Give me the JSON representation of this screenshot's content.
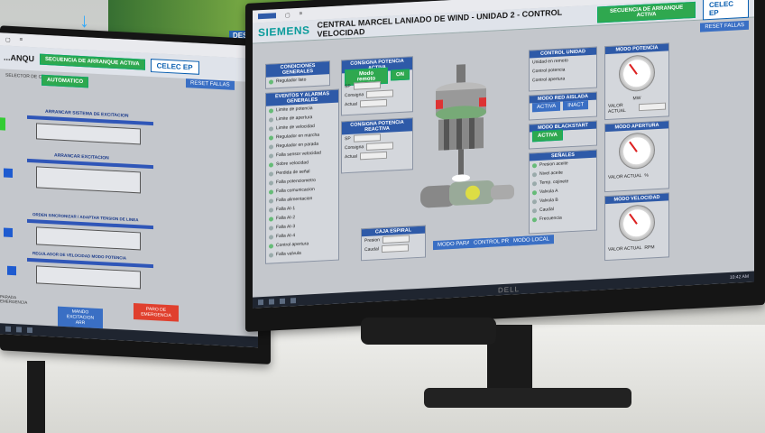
{
  "background": {
    "banner_label": "DESCARGA RIO",
    "arrow_icon": "down-arrow-icon"
  },
  "right_app": {
    "brand": "SIEMENS",
    "title": "CENTRAL MARCEL LANIADO DE WIND - UNIDAD 2 - CONTROL VELOCIDAD",
    "sequence_button": "SECUENCIA DE ARRANQUE ACTIVA",
    "logo": "CELEC EP",
    "reset_button": "RESET FALLAS",
    "panels": {
      "condiciones": {
        "header": "CONDICIONES GENERALES",
        "rows": [
          "Regulador listo"
        ]
      },
      "eventos": {
        "header": "EVENTOS Y ALARMAS GENERALES",
        "rows": [
          "Limite de potencia",
          "Limite de apertura",
          "Limite de velocidad",
          "Regulador en marcha",
          "Regulador en parada",
          "Falla sensor velocidad",
          "Sobre velocidad",
          "Perdida de señal",
          "Falla potenciometro",
          "Falla comunicacion",
          "Falla alimentacion",
          "Falla AI-1",
          "Falla AI-2",
          "Falla AI-3",
          "Falla AI-4",
          "Control apertura",
          "Falla valvula"
        ]
      },
      "consigna_activa": {
        "header": "CONSIGNA POTENCIA ACTIVA",
        "rows": [
          "SP",
          "Consigna",
          "Actual"
        ],
        "btn_a": "Modo remoto",
        "btn_b": "ON"
      },
      "consigna_reactiva": {
        "header": "CONSIGNA POTENCIA REACTIVA",
        "rows": [
          "SP",
          "Consigna",
          "Actual"
        ]
      },
      "control_unidad": {
        "header": "CONTROL UNIDAD",
        "rows": [
          "Unidad en remoto",
          "Control potencia",
          "Control apertura"
        ]
      },
      "modo_red": {
        "header": "MODO RED AISLADA",
        "btn_a": "ACTIVA",
        "btn_b": "INACT"
      },
      "modo_blackstart": {
        "header": "MODO BLACKSTART",
        "btn_a": "ACTIVA"
      },
      "senales": {
        "header": "SEÑALES",
        "rows": [
          "Presion aceite",
          "Nivel aceite",
          "Temp. cojinete",
          "Valvula A",
          "Valvula B",
          "Caudal",
          "Frecuencia"
        ]
      },
      "gauge_potencia": {
        "header": "MODO POTENCIA",
        "unit": "MW",
        "label": "VALOR ACTUAL"
      },
      "gauge_apertura": {
        "header": "MODO APERTURA",
        "unit": "%",
        "label": "VALOR ACTUAL"
      },
      "gauge_velocidad": {
        "header": "MODO VELOCIDAD",
        "unit": "RPM",
        "label": "VALOR ACTUAL"
      },
      "caja_espiral": {
        "header": "CAJA ESPIRAL",
        "rows": [
          "Presion",
          "Caudal"
        ]
      },
      "bottom_buttons": [
        "MODO PARALELO",
        "CONTROL PRESION",
        "MODO LOCAL"
      ]
    },
    "taskbar_clock": "10:42 AM"
  },
  "left_app": {
    "title": "...ANQU",
    "sequence_button": "SECUENCIA DE ARRANQUE ACTIVA",
    "logo": "CELEC EP",
    "selector": "SELECTOR DE CONTROL",
    "selector_value": "AUTOMATICO",
    "reset_button": "RESET FALLAS",
    "steps": [
      "ARRANCAR SISTEMA DE EXCITACION",
      "ARRANCAR EXCITACION",
      "ORDEN SINCRONIZAR / ADAPTAR TENSION DE LINEA",
      "REGULADOR DE VELOCIDAD MODO POTENCIA"
    ],
    "footer_btn_a": "MANDO EXCITACION ARR",
    "footer_btn_b": "PARO DE EMERGENCIA",
    "side_label": "PARADA EMERGENCIA"
  },
  "monitor": {
    "brand": "DELL"
  },
  "colors": {
    "accent_blue": "#2e5aa8",
    "green": "#2fa84f",
    "red": "#e0402e",
    "brand_teal": "#0a9b9b"
  }
}
